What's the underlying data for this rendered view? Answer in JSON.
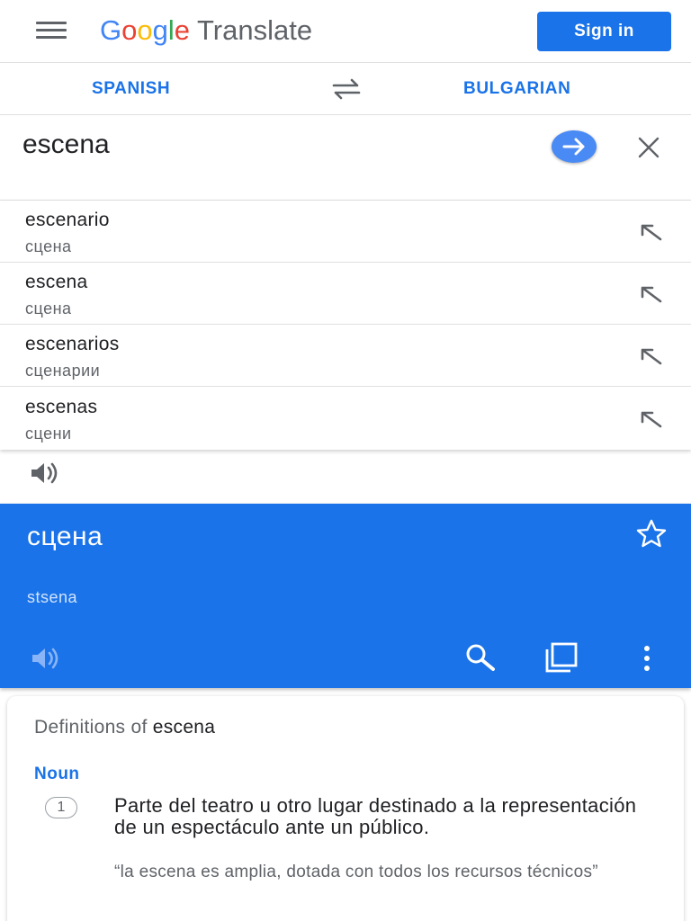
{
  "header": {
    "logo_parts": [
      "G",
      "o",
      "o",
      "g",
      "l",
      "e"
    ],
    "logo_colors": [
      "#4285f4",
      "#ea4335",
      "#fbbc05",
      "#4285f4",
      "#34a853",
      "#ea4335"
    ],
    "product_name": "Translate",
    "signin_label": "Sign in",
    "menu_icon": "hamburger-menu-icon"
  },
  "languages": {
    "source": "SPANISH",
    "target": "BULGARIAN",
    "swap_icon": "swap-arrows-icon"
  },
  "input": {
    "text": "escena",
    "go_icon": "arrow-right-icon",
    "clear_icon": "close-icon"
  },
  "suggestions": [
    {
      "word": "escenario",
      "translation": "сцена"
    },
    {
      "word": "escena",
      "translation": "сцена"
    },
    {
      "word": "escenarios",
      "translation": "сценарии"
    },
    {
      "word": "escenas",
      "translation": "сцени"
    }
  ],
  "result": {
    "text": "сцена",
    "transliteration": "stsena",
    "icons": [
      "star-icon",
      "speaker-icon",
      "search-icon",
      "copy-icon",
      "more-vert-icon"
    ]
  },
  "definitions": {
    "prefix": "Definitions of",
    "term": "escena",
    "part_of_speech": "Noun",
    "items": [
      {
        "number": "1",
        "text": "Parte del teatro u otro lugar destinado a la representación de un espectáculo ante un público.",
        "example": "“la escena es amplia, dotada con todos los recursos técnicos”"
      }
    ]
  },
  "colors": {
    "brand_blue": "#1a73e8",
    "text_primary": "#202124",
    "text_secondary": "#5f6368",
    "divider": "#e0e0e0"
  }
}
